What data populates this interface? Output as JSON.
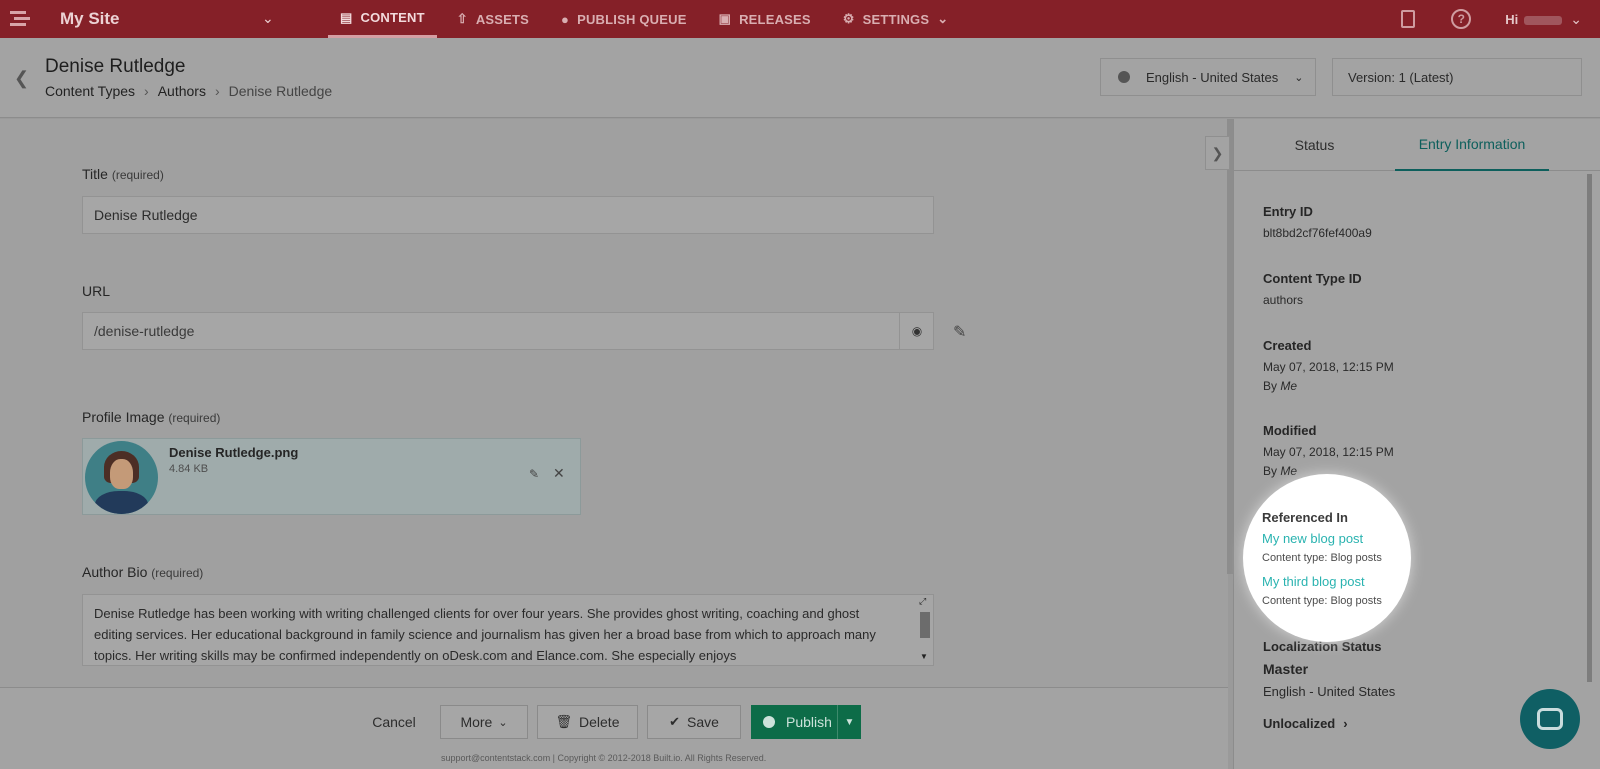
{
  "topbar": {
    "site_name": "My Site",
    "nav": [
      {
        "label": "CONTENT",
        "icon": "document-icon"
      },
      {
        "label": "ASSETS",
        "icon": "upload-icon"
      },
      {
        "label": "PUBLISH QUEUE",
        "icon": "globe-icon"
      },
      {
        "label": "RELEASES",
        "icon": "box-icon"
      },
      {
        "label": "SETTINGS",
        "icon": "gear-icon"
      }
    ],
    "help": "?",
    "greeting": "Hi"
  },
  "header": {
    "title": "Denise Rutledge",
    "breadcrumbs": [
      "Content Types",
      "Authors",
      "Denise Rutledge"
    ],
    "language": "English - United States",
    "version": "Version: 1 (Latest)"
  },
  "form": {
    "title_label": "Title",
    "title_value": "Denise Rutledge",
    "url_label": "URL",
    "url_value": "/denise-rutledge",
    "image_label": "Profile Image",
    "image_name": "Denise Rutledge.png",
    "image_size": "4.84 KB",
    "bio_label": "Author Bio",
    "bio_value": "Denise Rutledge has been working with writing challenged clients for over four years. She provides ghost writing, coaching and ghost editing services. Her educational background in family science and journalism has given her a broad base from which to approach many topics. Her writing skills may be confirmed independently on oDesk.com and Elance.com. She especially enjoys",
    "required": "(required)"
  },
  "footer": {
    "cancel": "Cancel",
    "more": "More",
    "delete": "Delete",
    "save": "Save",
    "publish": "Publish",
    "copyright": "support@contentstack.com | Copyright © 2012-2018 Built.io. All Rights Reserved."
  },
  "panel": {
    "tabs": [
      "Status",
      "Entry Information"
    ],
    "entry_id_label": "Entry ID",
    "entry_id": "blt8bd2cf76fef400a9",
    "ctype_label": "Content Type ID",
    "ctype": "authors",
    "created_label": "Created",
    "created": "May 07, 2018, 12:15 PM",
    "modified_label": "Modified",
    "modified": "May 07, 2018, 12:15 PM",
    "by": "By",
    "by_who": "Me",
    "referenced_label": "Referenced In",
    "references": [
      {
        "title": "My new blog post",
        "type": "Content type: Blog posts"
      },
      {
        "title": "My third blog post",
        "type": "Content type: Blog posts"
      }
    ],
    "loc_label": "Localization Status",
    "loc_master": "Master",
    "loc_lang": "English - United States",
    "unlocalized": "Unlocalized"
  },
  "colors": {
    "topbar": "#852028",
    "accent": "#2ab3b0",
    "publish": "#0d6c48"
  }
}
